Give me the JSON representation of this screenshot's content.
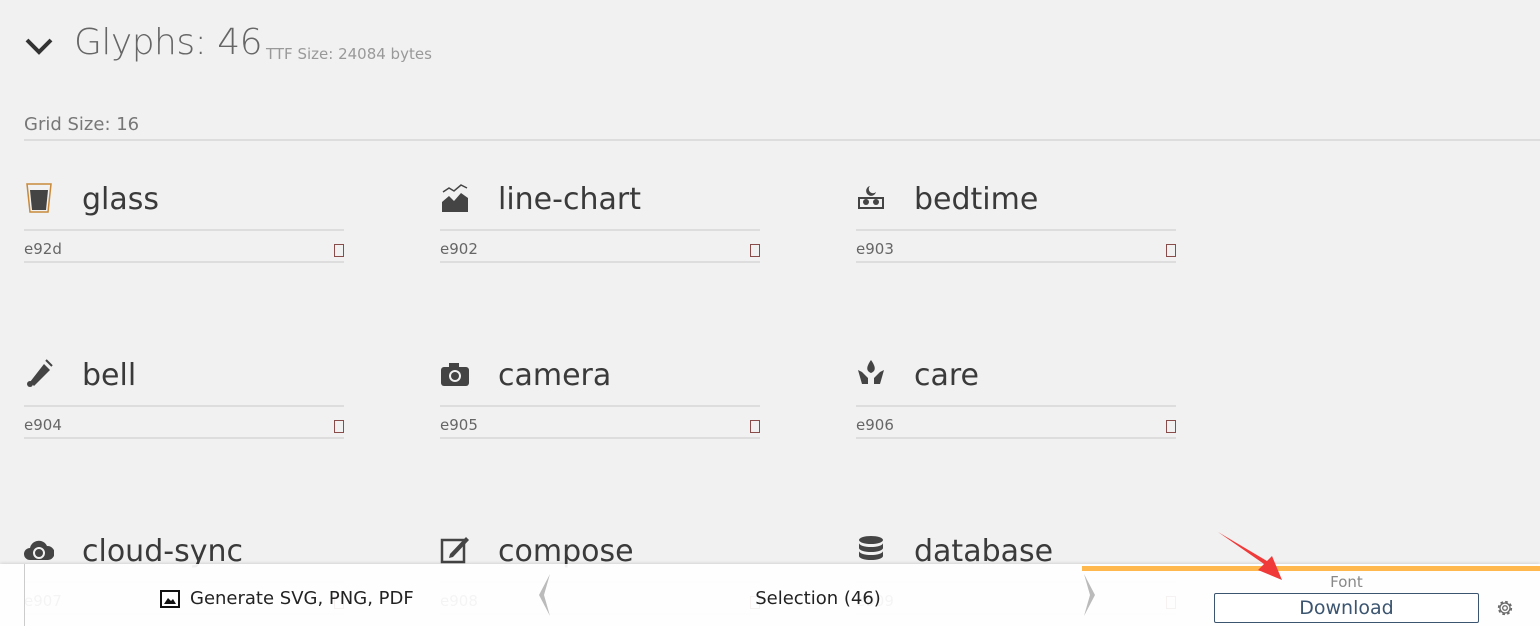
{
  "header": {
    "title": "Glyphs: 46",
    "ttf_size": "TTF Size: 24084 bytes",
    "grid_size": "Grid Size: 16"
  },
  "glyphs": [
    {
      "name": "glass",
      "code": "e92d",
      "icon": "glass-icon"
    },
    {
      "name": "line-chart",
      "code": "e902",
      "icon": "line-chart-icon"
    },
    {
      "name": "bedtime",
      "code": "e903",
      "icon": "bedtime-icon"
    },
    {
      "name": "bell",
      "code": "e904",
      "icon": "bell-icon"
    },
    {
      "name": "camera",
      "code": "e905",
      "icon": "camera-icon"
    },
    {
      "name": "care",
      "code": "e906",
      "icon": "care-icon"
    },
    {
      "name": "cloud-sync",
      "code": "e907",
      "icon": "cloud-sync-icon"
    },
    {
      "name": "compose",
      "code": "e908",
      "icon": "compose-icon"
    },
    {
      "name": "database",
      "code": "e909",
      "icon": "database-icon"
    }
  ],
  "footer": {
    "generate_label": "Generate SVG, PNG, PDF",
    "selection_label": "Selection (46)",
    "font_label": "Font",
    "download_label": "Download"
  },
  "colors": {
    "accent": "#ffb84d",
    "download_border": "#3b5570",
    "annotation_arrow": "#f03a3a"
  }
}
